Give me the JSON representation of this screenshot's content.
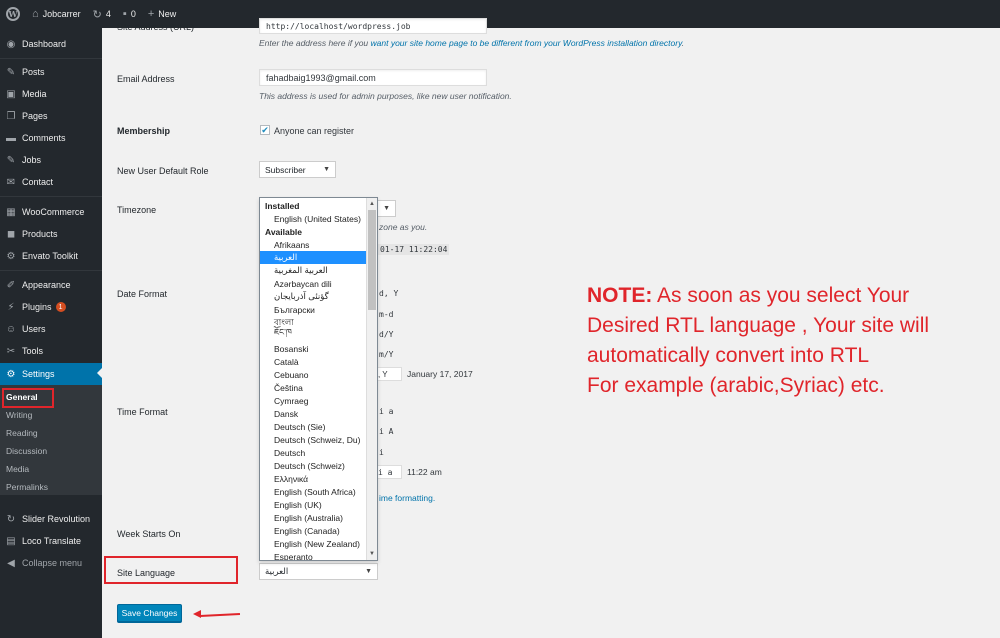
{
  "adminbar": {
    "site_name": "Jobcarrer",
    "updates_count": "4",
    "comments_count": "0",
    "new_label": "New"
  },
  "sidebar": {
    "items": [
      {
        "label": "Dashboard",
        "icon": "dashboard-icon"
      },
      {
        "label": "Posts",
        "icon": "pin-icon"
      },
      {
        "label": "Media",
        "icon": "media-icon"
      },
      {
        "label": "Pages",
        "icon": "pages-icon"
      },
      {
        "label": "Comments",
        "icon": "comment-icon"
      },
      {
        "label": "Jobs",
        "icon": "pin-icon"
      },
      {
        "label": "Contact",
        "icon": "mail-icon"
      },
      {
        "label": "WooCommerce",
        "icon": "cart-icon"
      },
      {
        "label": "Products",
        "icon": "box-icon"
      },
      {
        "label": "Envato Toolkit",
        "icon": "plugin-icon"
      },
      {
        "label": "Appearance",
        "icon": "brush-icon"
      },
      {
        "label": "Plugins",
        "icon": "plugin-icon",
        "badge": "1"
      },
      {
        "label": "Users",
        "icon": "user-icon"
      },
      {
        "label": "Tools",
        "icon": "wrench-icon"
      },
      {
        "label": "Settings",
        "icon": "settings-icon"
      }
    ],
    "submenu": [
      "General",
      "Writing",
      "Reading",
      "Discussion",
      "Media",
      "Permalinks"
    ],
    "extra": [
      "Slider Revolution",
      "Loco Translate"
    ],
    "collapse_label": "Collapse menu"
  },
  "form": {
    "site_address_label": "Site Address (URL)",
    "site_address_value": "http://localhost/wordpress.job",
    "site_address_desc_prefix": "Enter the address here if you ",
    "site_address_desc_link": "want your site home page to be different from your WordPress installation directory",
    "site_address_desc_suffix": ".",
    "email_label": "Email Address",
    "email_value": "fahadbaig1993@gmail.com",
    "email_desc": "This address is used for admin purposes, like new user notification.",
    "membership_label": "Membership",
    "membership_checkbox": "Anyone can register",
    "role_label": "New User Default Role",
    "role_value": "Subscriber",
    "timezone_label": "Timezone",
    "timezone_frag": "zone as you.",
    "time_frag": "01-17 11:22:04",
    "date_format_label": "Date Format",
    "date_frags": [
      "d, Y",
      "m-d",
      "d/Y",
      "m/Y",
      ", Y"
    ],
    "date_custom_preview": "January 17, 2017",
    "time_format_label": "Time Format",
    "time_frags": [
      "i a",
      "i A",
      "i",
      "i a"
    ],
    "time_custom_preview": "11:22 am",
    "time_link_frag": "ime formatting.",
    "week_label": "Week Starts On",
    "language_label": "Site Language",
    "language_value": "العربية",
    "save_label": "Save Changes"
  },
  "language_dropdown": {
    "options": [
      {
        "label": "Installed",
        "group": true
      },
      {
        "label": "English (United States)"
      },
      {
        "label": "Available",
        "group": true
      },
      {
        "label": "Afrikaans"
      },
      {
        "label": "العربية",
        "selected": true
      },
      {
        "label": "العربية المغربية"
      },
      {
        "label": "Azərbaycan dili"
      },
      {
        "label": "گؤنئی آذربایجان"
      },
      {
        "label": "Български"
      },
      {
        "label": "বাংলা"
      },
      {
        "label": "ཇོང་ཁ"
      },
      {
        "label": "Bosanski"
      },
      {
        "label": "Català"
      },
      {
        "label": "Cebuano"
      },
      {
        "label": "Čeština"
      },
      {
        "label": "Cymraeg"
      },
      {
        "label": "Dansk"
      },
      {
        "label": "Deutsch (Sie)"
      },
      {
        "label": "Deutsch (Schweiz, Du)"
      },
      {
        "label": "Deutsch"
      },
      {
        "label": "Deutsch (Schweiz)"
      },
      {
        "label": "Ελληνικά"
      },
      {
        "label": "English (South Africa)"
      },
      {
        "label": "English (UK)"
      },
      {
        "label": "English (Australia)"
      },
      {
        "label": "English (Canada)"
      },
      {
        "label": "English (New Zealand)"
      },
      {
        "label": "Esperanto"
      }
    ]
  },
  "note": {
    "head": "NOTE:",
    "line1": " As soon as you select Your",
    "line2": "Desired RTL language , Your site will",
    "line3": "automatically convert into RTL",
    "line4": "For example (arabic,Syriac) etc."
  },
  "colors": {
    "accent": "#0073aa",
    "annotation": "#e0252b",
    "sidebar_bg": "#23282d"
  }
}
